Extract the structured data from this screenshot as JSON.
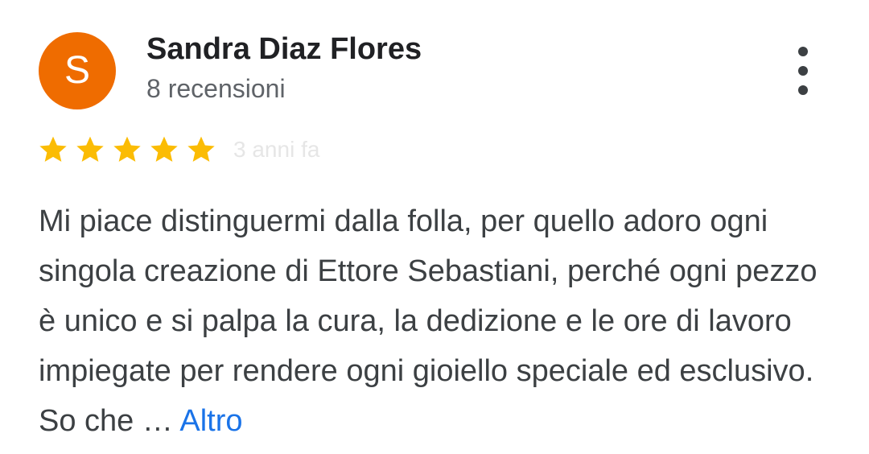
{
  "review": {
    "author": {
      "avatar_letter": "S",
      "avatar_color": "#EF6C00",
      "name": "Sandra Diaz Flores",
      "review_count": "8 recensioni"
    },
    "rating": {
      "stars": 5,
      "max_stars": 5,
      "star_color": "#FBBC04",
      "date": "3 anni fa"
    },
    "text": "Mi piace distinguermi dalla folla, per quello adoro ogni singola creazione di Ettore Sebastiani, perché ogni pezzo è unico e si palpa la cura, la dedizione e le ore di lavoro impiegate per rendere ogni gioiello speciale ed esclusivo. So che …",
    "more_label": "Altro",
    "more_link_color": "#1a73e8",
    "menu_icon": "more-vert-icon"
  }
}
